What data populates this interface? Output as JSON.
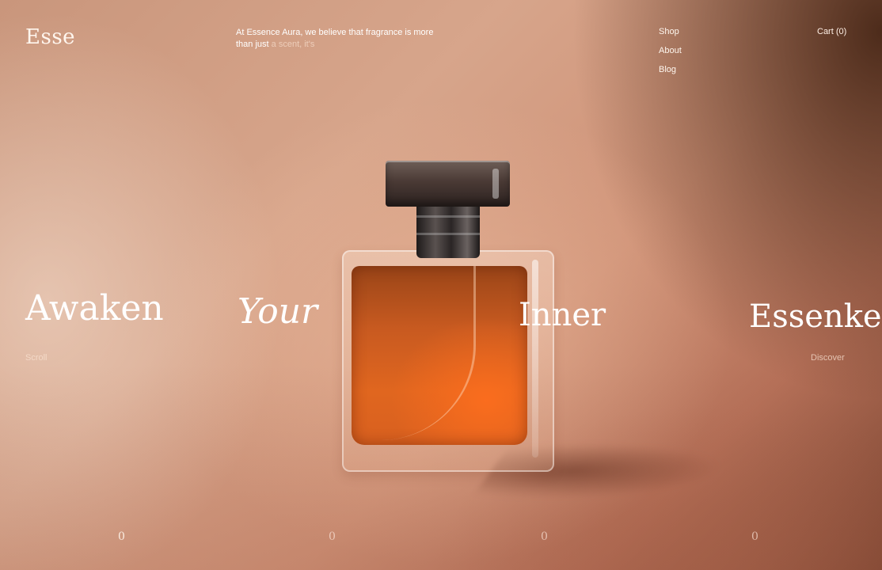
{
  "brand": {
    "logo_text": "Esse"
  },
  "intro": {
    "text_main": "At Essence Aura, we believe that fragrance is more than just",
    "text_faded": "a scent, it's"
  },
  "nav": {
    "items": [
      {
        "label": "Shop"
      },
      {
        "label": "About"
      },
      {
        "label": "Blog"
      }
    ],
    "cart_label": "Cart (0)"
  },
  "hero": {
    "words": [
      "Awaken",
      "Your",
      "Inner",
      "Essenke"
    ],
    "scroll_label": "Scroll",
    "discover_label": "Discover",
    "image_subject": "perfume bottle"
  },
  "counters": [
    "0",
    "0",
    "0",
    "0"
  ],
  "colors": {
    "background": "#d9a58a",
    "liquid": "#e0661f",
    "text": "#ffffff"
  }
}
